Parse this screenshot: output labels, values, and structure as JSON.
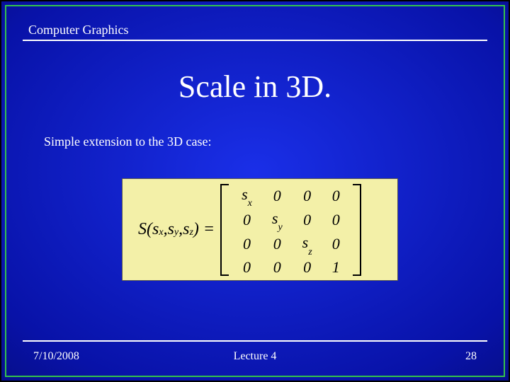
{
  "header": {
    "course_label": "Computer Graphics"
  },
  "title": "Scale in 3D.",
  "body": {
    "intro": "Simple extension to the 3D case:"
  },
  "formula": {
    "func": "S",
    "args": [
      "s",
      "s",
      "s"
    ],
    "arg_subs": [
      "x",
      "y",
      "z"
    ],
    "eq": ") = ",
    "open_paren": "(",
    "comma": ", ",
    "matrix": [
      [
        {
          "v": "s",
          "sub": "x"
        },
        {
          "v": "0"
        },
        {
          "v": "0"
        },
        {
          "v": "0"
        }
      ],
      [
        {
          "v": "0"
        },
        {
          "v": "s",
          "sub": "y"
        },
        {
          "v": "0"
        },
        {
          "v": "0"
        }
      ],
      [
        {
          "v": "0"
        },
        {
          "v": "0"
        },
        {
          "v": "s",
          "sub": "z"
        },
        {
          "v": "0"
        }
      ],
      [
        {
          "v": "0"
        },
        {
          "v": "0"
        },
        {
          "v": "0"
        },
        {
          "v": "1"
        }
      ]
    ]
  },
  "footer": {
    "date": "7/10/2008",
    "center": "Lecture 4",
    "page": "28"
  }
}
